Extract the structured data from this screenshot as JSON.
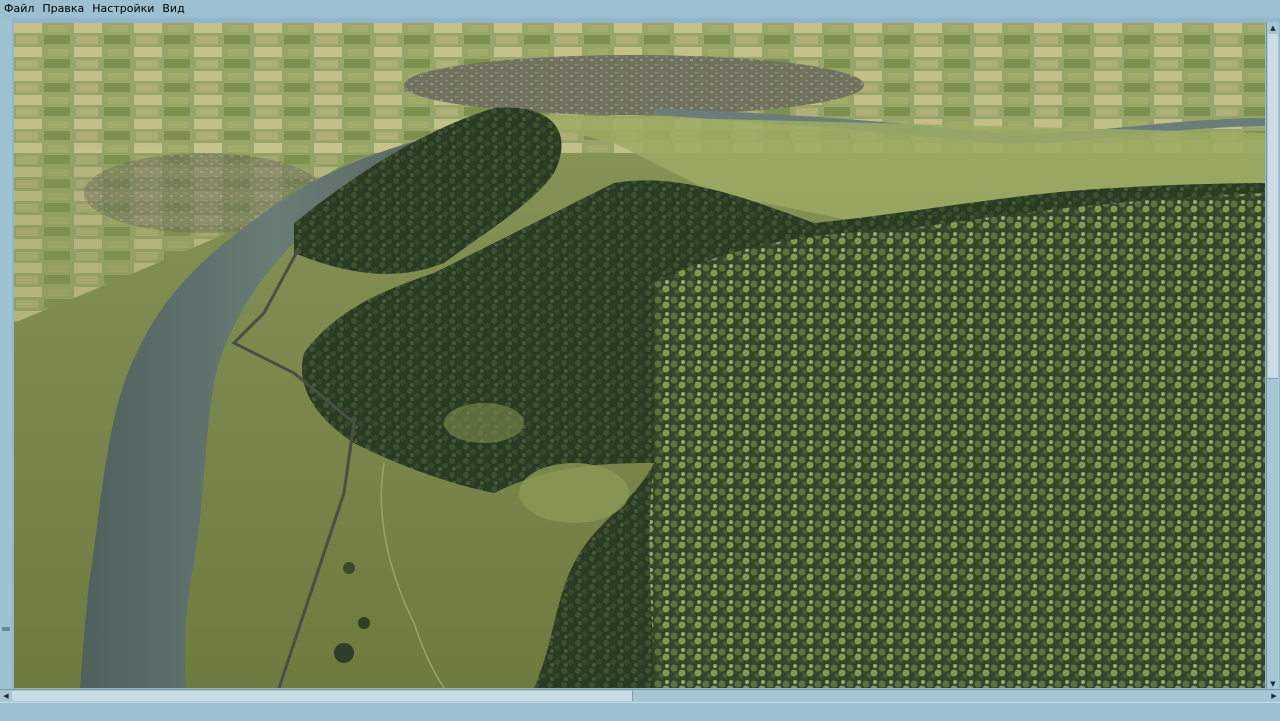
{
  "menu": {
    "items": [
      "Файл",
      "Правка",
      "Настройки",
      "Вид"
    ]
  },
  "viewport": {
    "scene": "aerial-terrain-forest-river-town"
  },
  "colors": {
    "chrome": "#9cc0cf",
    "scrollbar": "#a6c6d4",
    "river": "#5d6d68",
    "forest": "#2e3d23",
    "field": "#7d8a4a"
  },
  "icons": {
    "scroll_up": "triangle-up",
    "scroll_down": "triangle-down",
    "scroll_left": "triangle-left",
    "scroll_right": "triangle-right"
  }
}
